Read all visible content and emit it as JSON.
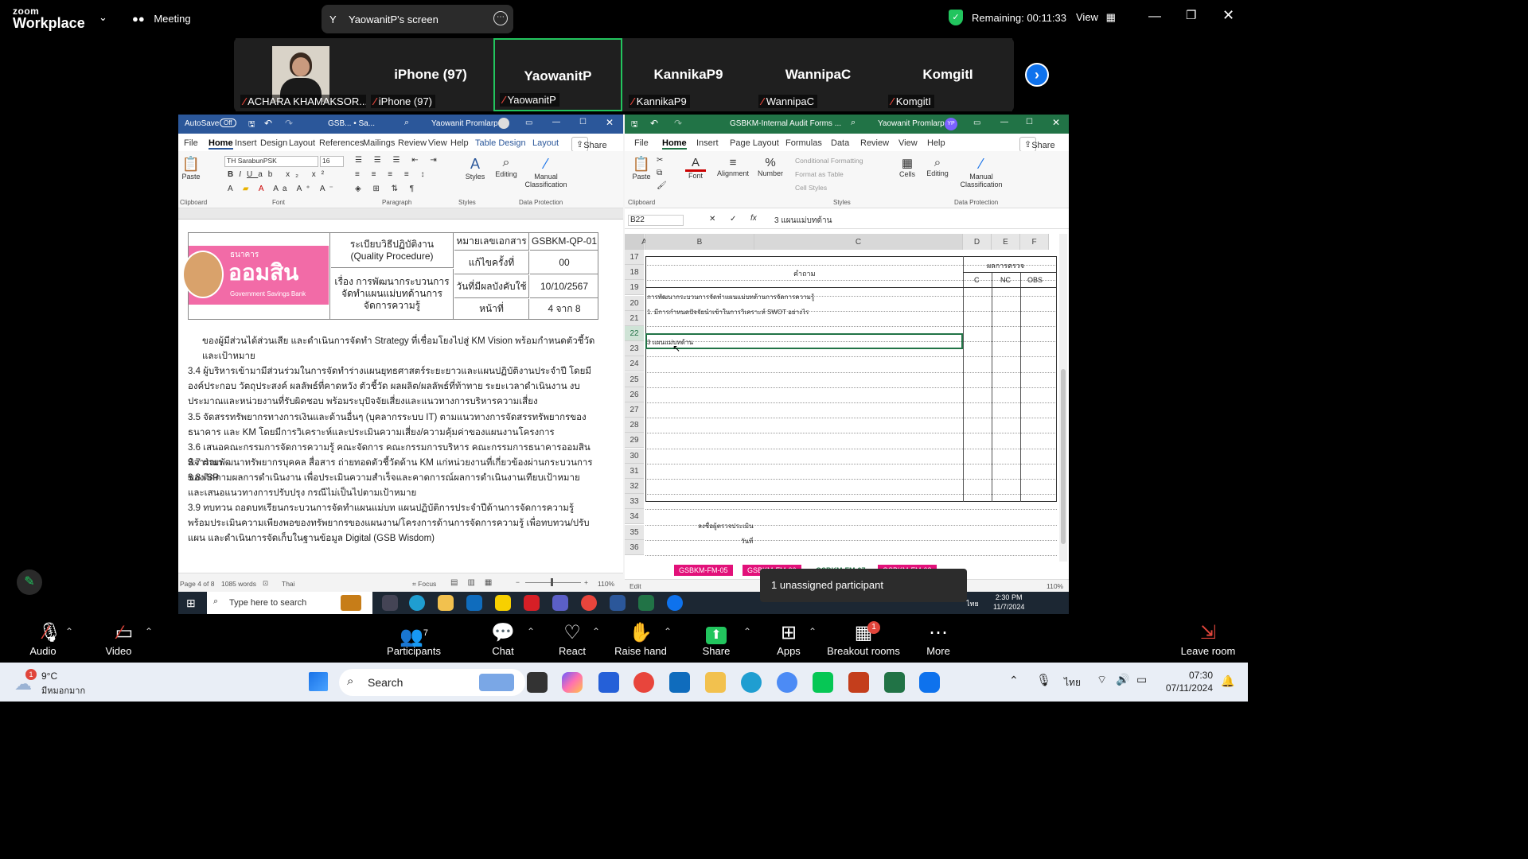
{
  "zoom": {
    "brand_top": "zoom",
    "brand_bottom": "Workplace",
    "meeting_label": "Meeting",
    "screen_tab_initial": "Y",
    "screen_tab_label": "YaowanitP's screen",
    "remaining": "Remaining: 00:11:33",
    "view_label": "View"
  },
  "participants": [
    {
      "name": "ACHARA KHAMAKSOR...",
      "big": ""
    },
    {
      "name": "iPhone (97)",
      "big": "iPhone (97)"
    },
    {
      "name": "YaowanitP",
      "big": "YaowanitP"
    },
    {
      "name": "KannikaP9",
      "big": "KannikaP9"
    },
    {
      "name": "WannipaC",
      "big": "WannipaC"
    },
    {
      "name": "KomgitI",
      "big": "KomgitI"
    }
  ],
  "word": {
    "autosave": "AutoSave",
    "autosave_state": "Off",
    "title": "GSB... • Sa...",
    "user": "Yaowanit Promlarp",
    "menus": [
      "File",
      "Home",
      "Insert",
      "Design",
      "Layout",
      "References",
      "Mailings",
      "Review",
      "View",
      "Help",
      "Table Design",
      "Layout"
    ],
    "share": "Share",
    "font_name": "TH SarabunPSK",
    "font_size": "16",
    "ribbon_groups": [
      "Clipboard",
      "Font",
      "Paragraph",
      "Styles",
      "Data Protection"
    ],
    "paste": "Paste",
    "styles": "Styles",
    "editing": "Editing",
    "manual_classification": "Manual Classification",
    "logo_bank": "ธนาคาร",
    "logo_name": "ออมสิน",
    "logo_sub": "Government Savings Bank",
    "table": {
      "proc_th": "ระเบียบวิธีปฏิบัติงาน",
      "proc_en": "(Quality Procedure)",
      "subject": "เรื่อง การพัฒนากระบวนการจัดทำแผนแม่บทด้านการจัดการความรู้",
      "doc_no_label": "หมายเลขเอกสาร",
      "doc_no": "GSBKM-QP-01",
      "rev_label": "แก้ไขครั้งที่",
      "rev": "00",
      "date_label": "วันที่มีผลบังคับใช้",
      "date": "10/10/2567",
      "page_label": "หน้าที่",
      "page": "4 จาก 8"
    },
    "paragraphs": [
      "ของผู้มีส่วนได้ส่วนเสีย และดำเนินการจัดทำ Strategy ที่เชื่อมโยงไปสู่ KM Vision พร้อมกำหนดตัวชี้วัดและเป้าหมาย",
      "3.4 ผู้บริหารเข้ามามีส่วนร่วมในการจัดทำร่างแผนยุทธศาสตร์ระยะยาวและแผนปฏิบัติงานประจำปี โดยมีองค์ประกอบ วัตถุประสงค์ ผลลัพธ์ที่คาดหวัง ตัวชี้วัด ผลผลิต/ผลลัพธ์ที่ท้าทาย ระยะเวลาดำเนินงาน งบประมาณและหน่วยงานที่รับผิดชอบ พร้อมระบุปัจจัยเสี่ยงและแนวทางการบริหารความเสี่ยง",
      "3.5 จัดสรรทรัพยากรทางการเงินและด้านอื่นๆ (บุคลากรระบบ IT) ตามแนวทางการจัดสรรทรัพยากรของธนาคาร และ KM โดยมีการวิเคราะห์และประเมินความเสี่ยง/ความคุ้มค่าของแผนงานโครงการ",
      "3.6 เสนอคณะกรรมการจัดการความรู้ คณะจัดการ คณะกรรมการบริหาร คณะกรรมการธนาคารออมสินพิจารณา",
      "3.7 ฝ่ายพัฒนาทรัพยากรบุคคล สื่อสาร ถ่ายทอดตัวชี้วัดด้าน KM แก่หน่วยงานที่เกี่ยวข้องผ่านกระบวนการของ SP",
      "3.8 ติดตามผลการดำเนินงาน เพื่อประเมินความสำเร็จและคาดการณ์ผลการดำเนินงานเทียบเป้าหมาย และเสนอแนวทางการปรับปรุง กรณีไม่เป็นไปตามเป้าหมาย",
      "3.9 ทบทวน ถอดบทเรียนกระบวนการจัดทำแผนแม่บท แผนปฏิบัติการประจำปีด้านการจัดการความรู้พร้อมประเมินความเพียงพอของทรัพยากรของแผนงาน/โครงการด้านการจัดการความรู้ เพื่อทบทวน/ปรับแผน และดำเนินการจัดเก็บในฐานข้อมูล Digital (GSB Wisdom)"
    ],
    "status_page": "Page 4 of 8",
    "status_words": "1085 words",
    "status_lang": "Thai",
    "status_focus": "Focus",
    "zoom_pct": "110%"
  },
  "excel": {
    "title": "GSBKM-Internal Audit Forms ...",
    "user": "Yaowanit Promlarp",
    "user_initials": "YP",
    "menus": [
      "File",
      "Home",
      "Insert",
      "Page Layout",
      "Formulas",
      "Data",
      "Review",
      "View",
      "Help"
    ],
    "share": "Share",
    "ribbon": {
      "paste": "Paste",
      "font": "Font",
      "alignment": "Alignment",
      "number": "Number",
      "cond_format": "Conditional Formatting",
      "format_table": "Format as Table",
      "cell_styles": "Cell Styles",
      "cells": "Cells",
      "editing": "Editing",
      "manual_classification": "Manual Classification",
      "grp_clipboard": "Clipboard",
      "grp_styles": "Styles",
      "grp_data_protection": "Data Protection"
    },
    "name_box": "B22",
    "formula": "3 แผนแม่บทด้าน",
    "columns": [
      "A",
      "B",
      "C",
      "D",
      "E",
      "F"
    ],
    "rows": [
      "17",
      "18",
      "19",
      "20",
      "21",
      "22",
      "23",
      "24",
      "25",
      "26",
      "27",
      "28",
      "29",
      "30",
      "31",
      "32",
      "33",
      "34",
      "35",
      "36"
    ],
    "header_question": "คำถาม",
    "header_result": "ผลการตรวจ",
    "header_c": "C",
    "header_nc": "NC",
    "header_obs": "OBS",
    "row19": "การพัฒนากระบวนการจัดทำแผนแม่บทด้านการจัดการความรู้",
    "row20": "1. มีการกำหนดปัจจัยนำเข้าในการวิเคราะห์ SWOT อย่างไร",
    "row22": "3 แผนแม่บทด้าน",
    "row34": "ลงชื่อผู้ตรวจประเมิน",
    "row35": "วันที่",
    "sheet_tabs": [
      "GSBKM-FM-05",
      "GSBKM-FM-06",
      "GSBKM-FM-07",
      "GSBKM-FM-08"
    ],
    "status": "Edit",
    "zoom_pct": "110%"
  },
  "inner_taskbar": {
    "search_placeholder": "Type here to search",
    "time": "2:30 PM",
    "date": "11/7/2024",
    "lang": "ไทย"
  },
  "toast": "1 unassigned participant",
  "toolbar": {
    "audio": "Audio",
    "video": "Video",
    "participants": "Participants",
    "participants_count": "7",
    "chat": "Chat",
    "react": "React",
    "raise_hand": "Raise hand",
    "share": "Share",
    "apps": "Apps",
    "breakout": "Breakout rooms",
    "breakout_badge": "1",
    "more": "More",
    "leave": "Leave room"
  },
  "windows": {
    "weather_temp": "9°C",
    "weather_desc": "มีหมอกมาก",
    "weather_badge": "1",
    "search": "Search",
    "lang": "ไทย",
    "time": "07:30",
    "date": "07/11/2024"
  },
  "colors": {
    "word_blue": "#2b579a",
    "excel_green": "#217346",
    "zoom_blue": "#0e72ed",
    "active_green": "#22c55e",
    "mute_red": "#e0453b",
    "gsb_pink": "#e2117a"
  }
}
